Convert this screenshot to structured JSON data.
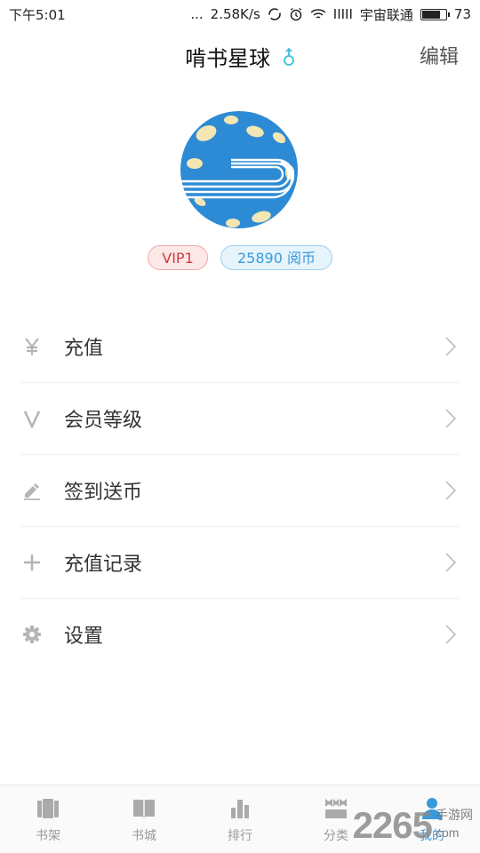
{
  "status_bar": {
    "time": "下午5:01",
    "dots": "...",
    "speed": "2.58K/s",
    "signal": "IIIII",
    "carrier": "宇宙联通",
    "battery": "73",
    "battery_level": 0.73
  },
  "header": {
    "title": "啃书星球",
    "edit_label": "编辑"
  },
  "profile": {
    "vip_badge": "VIP1",
    "coins_badge": "25890  阅币"
  },
  "menu": {
    "items": [
      {
        "label": "充值",
        "icon": "yen-icon"
      },
      {
        "label": "会员等级",
        "icon": "v-icon"
      },
      {
        "label": "签到送币",
        "icon": "pencil-icon"
      },
      {
        "label": "充值记录",
        "icon": "plus-icon"
      },
      {
        "label": "设置",
        "icon": "gear-icon"
      }
    ]
  },
  "tabbar": {
    "items": [
      {
        "label": "书架",
        "icon": "bookshelf-icon"
      },
      {
        "label": "书城",
        "icon": "book-icon"
      },
      {
        "label": "排行",
        "icon": "bar-chart-icon"
      },
      {
        "label": "分类",
        "icon": "category-icon"
      },
      {
        "label": "我的",
        "icon": "user-icon",
        "active": true
      }
    ]
  },
  "watermark": {
    "number": "2265",
    "site": "手游网",
    "domain": "com"
  },
  "colors": {
    "accent": "#3a9ad9",
    "vip": "#d23c3c"
  }
}
